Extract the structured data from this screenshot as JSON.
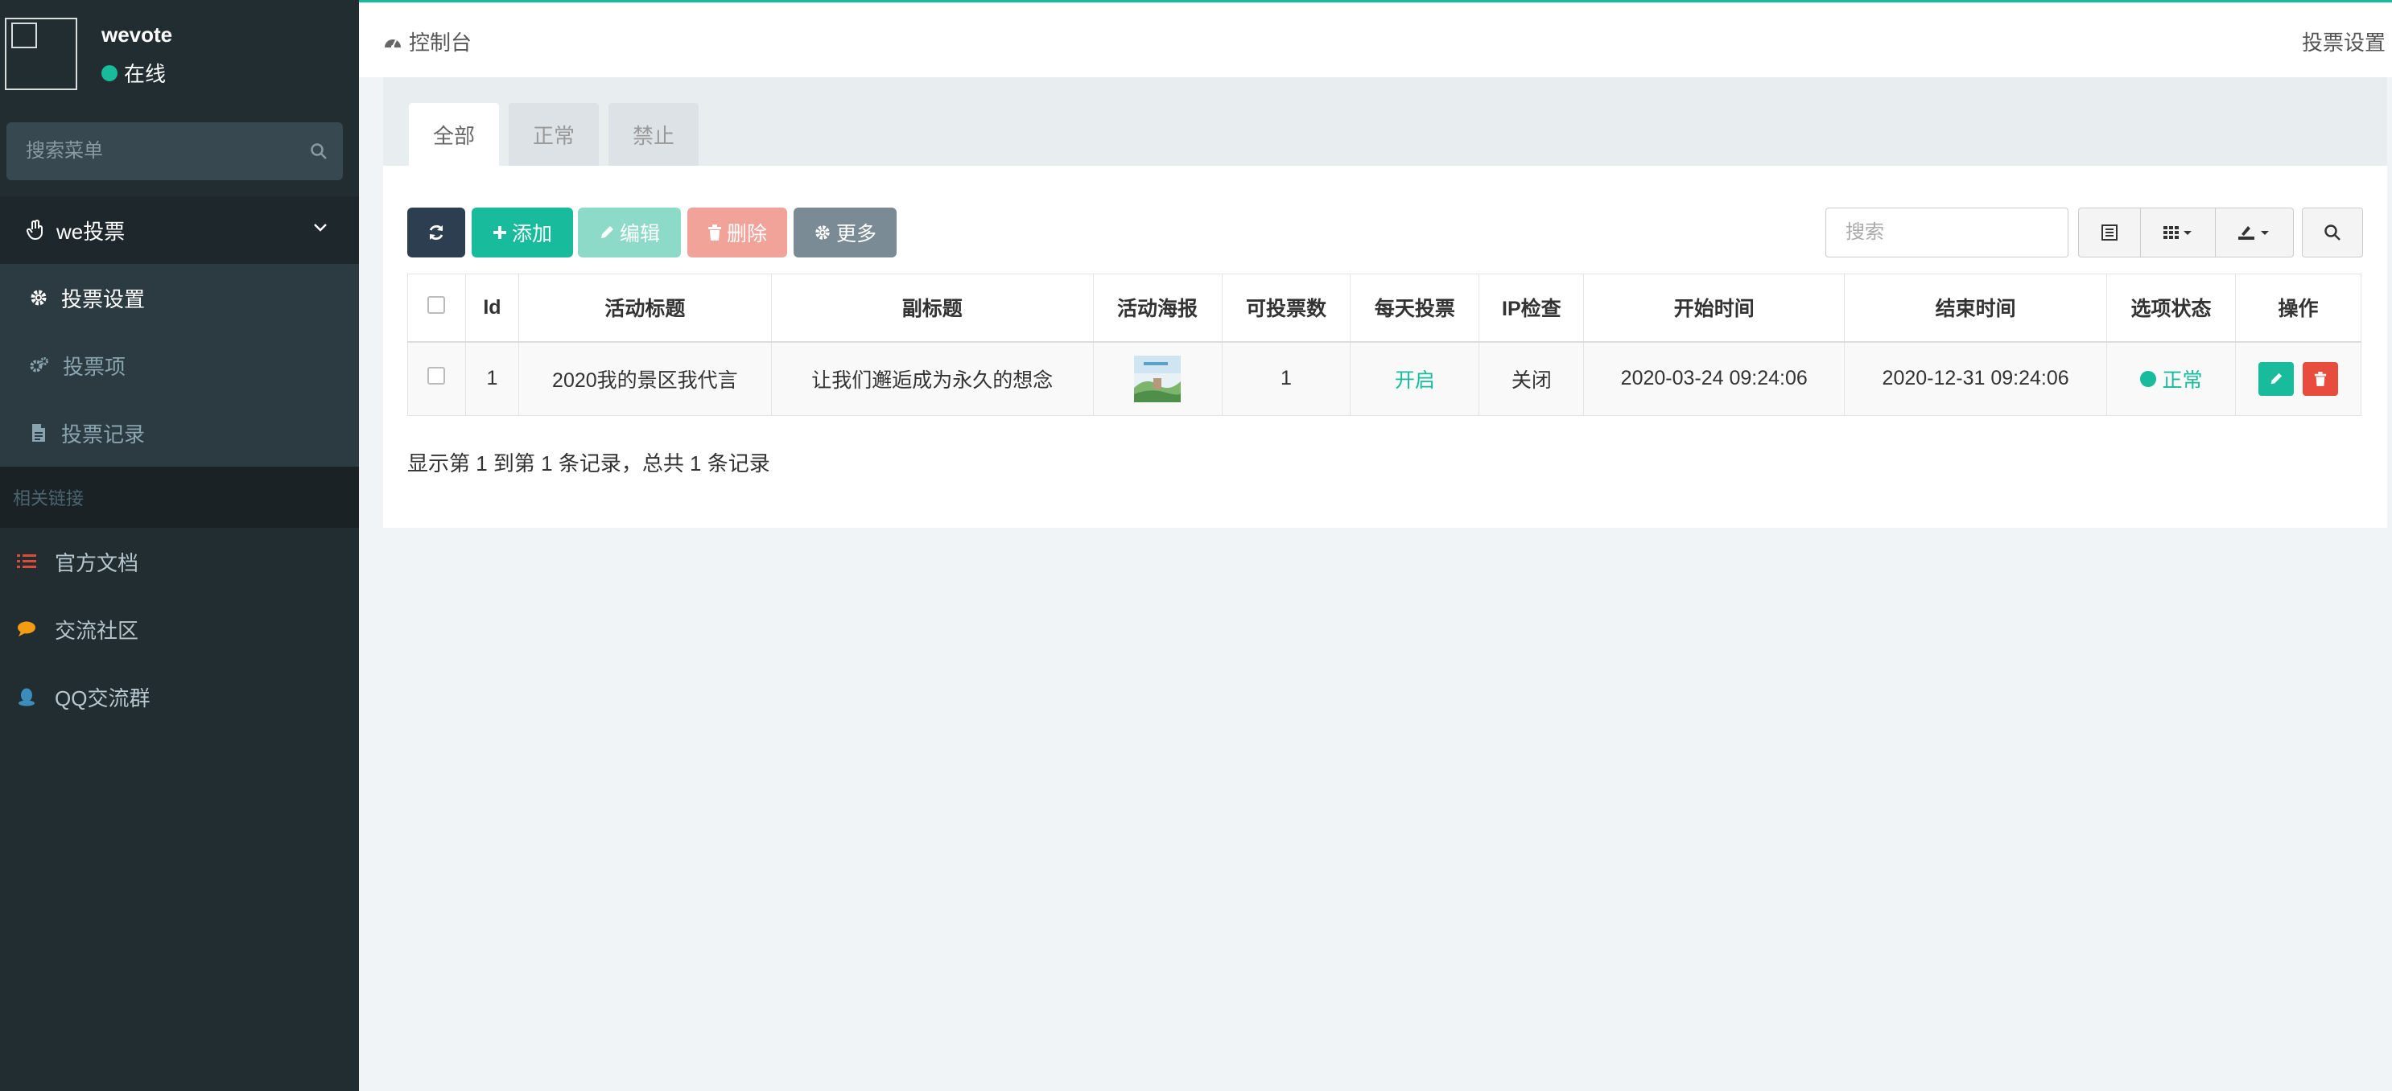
{
  "user": {
    "name": "wevote",
    "status": "在线"
  },
  "sidebar": {
    "search_placeholder": "搜索菜单",
    "group": {
      "label": "we投票"
    },
    "sub_items": [
      {
        "label": "投票设置",
        "active": true
      },
      {
        "label": "投票项",
        "active": false
      },
      {
        "label": "投票记录",
        "active": false
      }
    ],
    "links_header": "相关链接",
    "links": [
      {
        "label": "官方文档",
        "icon": "list-icon",
        "color": "#dd4b39"
      },
      {
        "label": "交流社区",
        "icon": "comment-icon",
        "color": "#f39c12"
      },
      {
        "label": "QQ交流群",
        "icon": "qq-icon",
        "color": "#3c8dbc"
      }
    ]
  },
  "topbar": {
    "home_label": "控制台",
    "page_label": "投票设置"
  },
  "tabs": [
    {
      "label": "全部",
      "active": true
    },
    {
      "label": "正常",
      "active": false
    },
    {
      "label": "禁止",
      "active": false
    }
  ],
  "toolbar": {
    "add_label": "添加",
    "edit_label": "编辑",
    "delete_label": "删除",
    "more_label": "更多",
    "search_placeholder": "搜索"
  },
  "table": {
    "columns": [
      "Id",
      "活动标题",
      "副标题",
      "活动海报",
      "可投票数",
      "每天投票",
      "IP检查",
      "开始时间",
      "结束时间",
      "选项状态",
      "操作"
    ],
    "rows": [
      {
        "id": "1",
        "title": "2020我的景区我代言",
        "subtitle": "让我们邂逅成为永久的想念",
        "votes": "1",
        "daily": "开启",
        "ip_check": "关闭",
        "start": "2020-03-24 09:24:06",
        "end": "2020-12-31 09:24:06",
        "status": "正常"
      }
    ]
  },
  "pager": {
    "summary": "显示第 1 到第 1 条记录，总共 1 条记录"
  },
  "colors": {
    "accent": "#18bc9c",
    "sidebar_bg": "#222d32",
    "danger": "#e74c3c",
    "dark_btn": "#2c3e50"
  }
}
